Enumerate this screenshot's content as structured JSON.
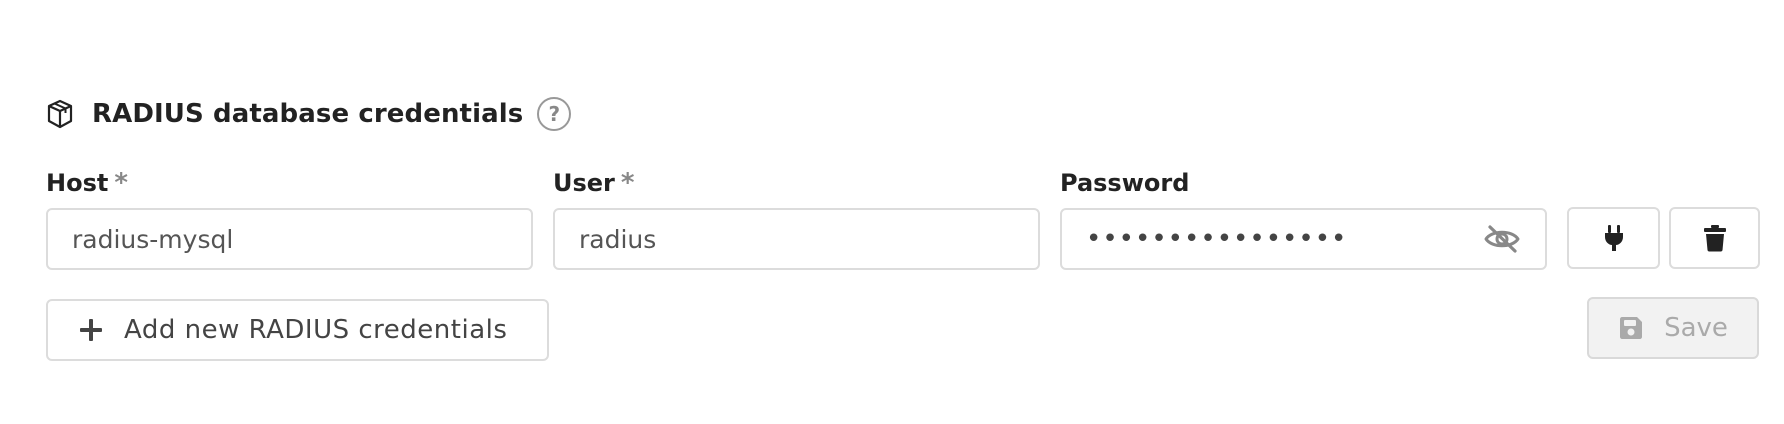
{
  "section": {
    "title": "RADIUS database credentials",
    "icon": "database-box-icon",
    "help_icon_text": "?"
  },
  "fields": {
    "host": {
      "label": "Host",
      "required_mark": "*",
      "value": "radius-mysql"
    },
    "user": {
      "label": "User",
      "required_mark": "*",
      "value": "radius"
    },
    "password": {
      "label": "Password",
      "value": "••••••••••••••••",
      "visibility_icon": "eye-slash-icon"
    }
  },
  "actions": {
    "test_connection_icon": "plug-icon",
    "delete_icon": "trash-icon",
    "add_label": "Add new RADIUS credentials",
    "save_label": "Save",
    "save_disabled": true
  },
  "colors": {
    "text": "#222222",
    "muted": "#888888",
    "border": "#dcdcdc",
    "disabled_bg": "#f2f2f2",
    "disabled_text": "#aaaaaa"
  }
}
